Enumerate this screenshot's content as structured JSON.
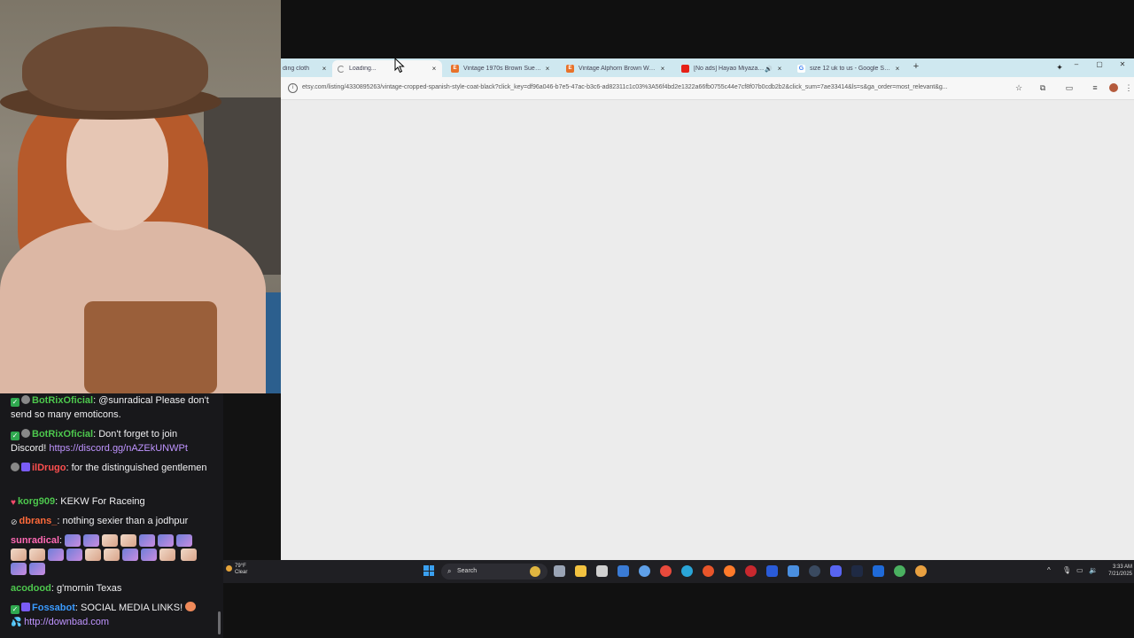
{
  "browser": {
    "tabs": [
      {
        "title": "ding cloth",
        "icon": "none",
        "active": false
      },
      {
        "title": "Loading...",
        "icon": "spinner",
        "active": true
      },
      {
        "title": "Vintage 1970s Brown Suede Co",
        "icon": "etsy",
        "active": false
      },
      {
        "title": "Vintage Alphorn Brown Wool T",
        "icon": "etsy",
        "active": false
      },
      {
        "title": "[No ads] Hayao Miyazaki A",
        "icon": "youtube",
        "active": false
      },
      {
        "title": "size 12 uk to us - Google Searc",
        "icon": "google",
        "active": false
      }
    ],
    "new_tab": "+",
    "close_glyph": "×",
    "window_controls": {
      "minimize": "–",
      "maximize": "▢",
      "close": "✕"
    },
    "url": "etsy.com/listing/4330895263/vintage-cropped-spanish-style-coat-black?click_key=df96a046-b7e5-47ac-b3c6-ad82311c1c03%3A56f4bd2e1322a66fb0755c44e7cf8f07b0cdb2b2&click_sum=7ae33414&ls=s&ga_order=most_relevant&g..."
  },
  "chat": {
    "messages": [
      {
        "badges": [
          "check",
          "bot"
        ],
        "user": "BotRixOficial",
        "user_color": "#4dc74d",
        "text": ": @sunradical Please don't send so many emoticons."
      },
      {
        "badges": [
          "check",
          "bot"
        ],
        "user": "BotRixOficial",
        "user_color": "#4dc74d",
        "text": ": Don't forget to join Discord! ",
        "link": "https://discord.gg/nAZEkUNWPt"
      },
      {
        "badges": [
          "bot",
          "sub"
        ],
        "user": "ilDrugo",
        "user_color": "#ff4f4f",
        "text": ": for the distinguished gentlemen"
      },
      {
        "badges": [
          "heart"
        ],
        "user": "korg909",
        "user_color": "#4dc74d",
        "text": ": KEKW For Raceing"
      },
      {
        "badges": [
          "mute"
        ],
        "user": "dbrans_",
        "user_color": "#ff6a3a",
        "text": ": nothing sexier than a jodhpur"
      },
      {
        "badges": [],
        "user": "sunradical",
        "user_color": "#ff69b4",
        "text": ":"
      },
      {
        "badges": [],
        "user": "acodood",
        "user_color": "#4dc74d",
        "text": ": g'mornin Texas"
      },
      {
        "badges": [
          "check",
          "sub"
        ],
        "user": "Fossabot",
        "user_color": "#3a9bff",
        "text": ": SOCIAL MEDIA LINKS! ",
        "link": "http://downbad.com"
      }
    ]
  },
  "taskbar": {
    "weather_temp": "79°F",
    "weather_desc": "Clear",
    "search_label": "Search",
    "time": "3:33 AM",
    "date": "7/21/2025",
    "tray_up": "^"
  },
  "colors": {
    "tabstrip": "#cfe8f0",
    "page_bg": "#ececec",
    "chat_bg": "#18181b",
    "taskbar_bg": "#1f1f23",
    "link": "#bf94ff"
  }
}
